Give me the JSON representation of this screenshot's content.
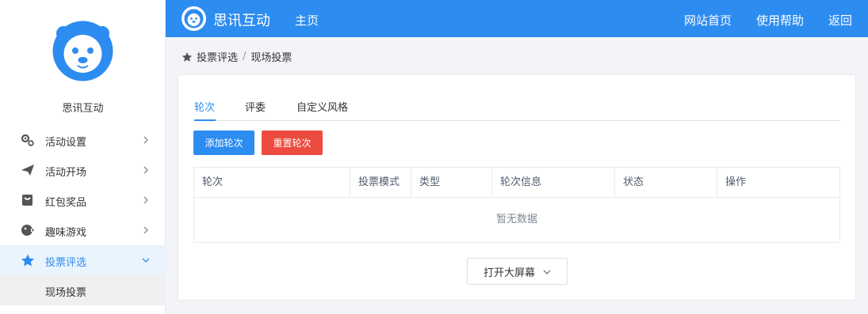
{
  "sidebar": {
    "org_name": "思讯互动",
    "menu": [
      {
        "label": "活动设置",
        "icon": "gear-icon"
      },
      {
        "label": "活动开场",
        "icon": "paper-plane-icon"
      },
      {
        "label": "红包奖品",
        "icon": "gift-icon"
      },
      {
        "label": "趣味游戏",
        "icon": "game-icon"
      },
      {
        "label": "投票评选",
        "icon": "star-icon",
        "active": true
      }
    ],
    "submenu": [
      {
        "label": "现场投票"
      }
    ]
  },
  "header": {
    "brand": "思讯互动",
    "home": "主页",
    "links": [
      "网站首页",
      "使用帮助",
      "返回"
    ],
    "color": "#2d8cf0"
  },
  "breadcrumb": {
    "items": [
      "投票评选",
      "现场投票"
    ],
    "separator": "/"
  },
  "tabs": [
    {
      "label": "轮次",
      "active": true
    },
    {
      "label": "评委"
    },
    {
      "label": "自定义风格"
    }
  ],
  "buttons": {
    "add": "添加轮次",
    "reset": "重置轮次"
  },
  "table": {
    "columns": [
      "轮次",
      "投票模式",
      "类型",
      "轮次信息",
      "状态",
      "操作"
    ],
    "empty_text": "暂无数据"
  },
  "bigscreen_button": "打开大屏幕",
  "colors": {
    "accent": "#2d8cf0",
    "danger": "#ed4b3f"
  }
}
